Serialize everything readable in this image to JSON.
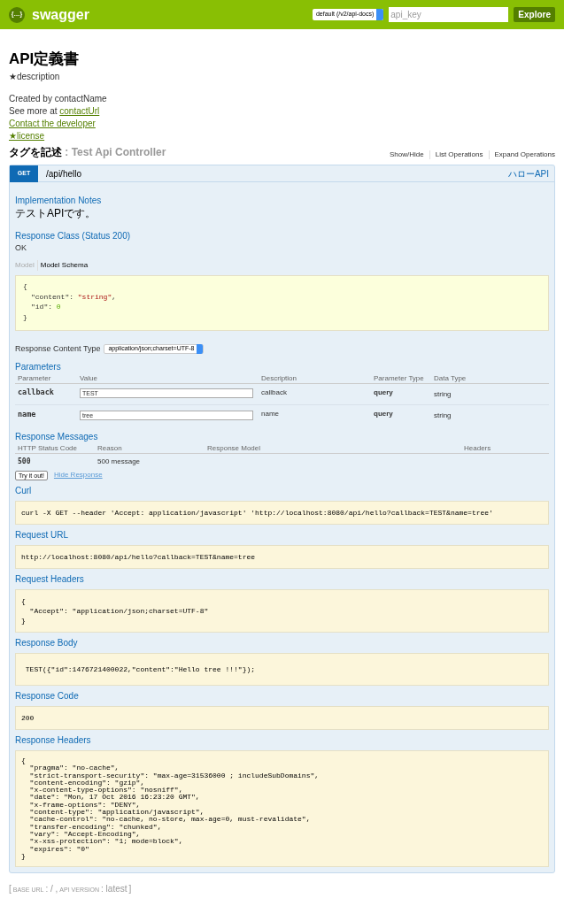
{
  "header": {
    "logo_icon": "{…}",
    "brand": "swagger",
    "spec_select": "default (/v2/api-docs)",
    "api_key_placeholder": "api_key",
    "explore": "Explore"
  },
  "info": {
    "title": "API定義書",
    "description": "★description",
    "created_by": "Created by contactName",
    "see_more_prefix": "See more at ",
    "see_more_link": "contactUrl",
    "contact_link": "Contact the developer",
    "license_link": "★license"
  },
  "resource": {
    "name": "タグを記述",
    "separator": " : ",
    "description": "Test Api Controller",
    "actions": [
      "Show/Hide",
      "List Operations",
      "Expand Operations"
    ]
  },
  "operation": {
    "method": "GET",
    "path": "/api/hello",
    "summary": "ハローAPI",
    "implementation_notes_title": "Implementation Notes",
    "implementation_notes": "テストAPIです。",
    "response_class_title": "Response Class (Status 200)",
    "response_class": "OK",
    "model_tabs": [
      {
        "label": "Model",
        "selected": false
      },
      {
        "label": "Model Schema",
        "selected": true
      }
    ],
    "schema": {
      "open": "{",
      "close": "}",
      "fields": [
        {
          "key": "\"content\":",
          "value": "\"string\"",
          "kind": "string",
          "comma": ","
        },
        {
          "key": "\"id\":",
          "value": "0",
          "kind": "number"
        }
      ]
    },
    "content_type_label": "Response Content Type",
    "content_type": "application/json;charset=UTF-8",
    "parameters_title": "Parameters",
    "parameter_columns": [
      "Parameter",
      "Value",
      "Description",
      "Parameter Type",
      "Data Type"
    ],
    "parameters": [
      {
        "name": "callback",
        "value": "TEST",
        "description": "callback",
        "type": "query",
        "data_type": "string"
      },
      {
        "name": "name",
        "value": "tree",
        "description": "name",
        "type": "query",
        "data_type": "string"
      }
    ],
    "messages_title": "Response Messages",
    "message_columns": [
      "HTTP Status Code",
      "Reason",
      "Response Model",
      "Headers"
    ],
    "messages": [
      {
        "code": "500",
        "reason": "500 message"
      }
    ],
    "try_button": "Try it out!",
    "hide_link": "Hide Response",
    "results": [
      {
        "title": "Curl",
        "code": "curl -X GET --header 'Accept: application/javascript' 'http://localhost:8080/api/hello?callback=TEST&name=tree'",
        "kind": "normal"
      },
      {
        "title": "Request URL",
        "code": "http://localhost:8080/api/hello?callback=TEST&name=tree",
        "kind": "normal"
      },
      {
        "title": "Request Headers",
        "code": "{\n  \"Accept\": \"application/json;charset=UTF-8\"\n}",
        "kind": "normal"
      },
      {
        "title": "Response Body",
        "code": " TEST({\"id\":1476721400022,\"content\":\"Hello tree !!!\"});",
        "kind": "tall"
      },
      {
        "title": "Response Code",
        "code": "200",
        "kind": "normal"
      },
      {
        "title": "Response Headers",
        "code": "{\n  \"pragma\": \"no-cache\",\n  \"strict-transport-security\": \"max-age=31536000 ; includeSubDomains\",\n  \"content-encoding\": \"gzip\",\n  \"x-content-type-options\": \"nosniff\",\n  \"date\": \"Mon, 17 Oct 2016 16:23:20 GMT\",\n  \"x-frame-options\": \"DENY\",\n  \"content-type\": \"application/javascript\",\n  \"cache-control\": \"no-cache, no-store, max-age=0, must-revalidate\",\n  \"transfer-encoding\": \"chunked\",\n  \"vary\": \"Accept-Encoding\",\n  \"x-xss-protection\": \"1; mode=block\",\n  \"expires\": \"0\"\n}",
        "kind": "dense"
      }
    ]
  },
  "footer": {
    "open": "[",
    "base_url_label": "BASE URL",
    "base_url": ": / ,",
    "api_version_label": "API VERSION",
    "api_version": ": latest",
    "close": "]"
  }
}
